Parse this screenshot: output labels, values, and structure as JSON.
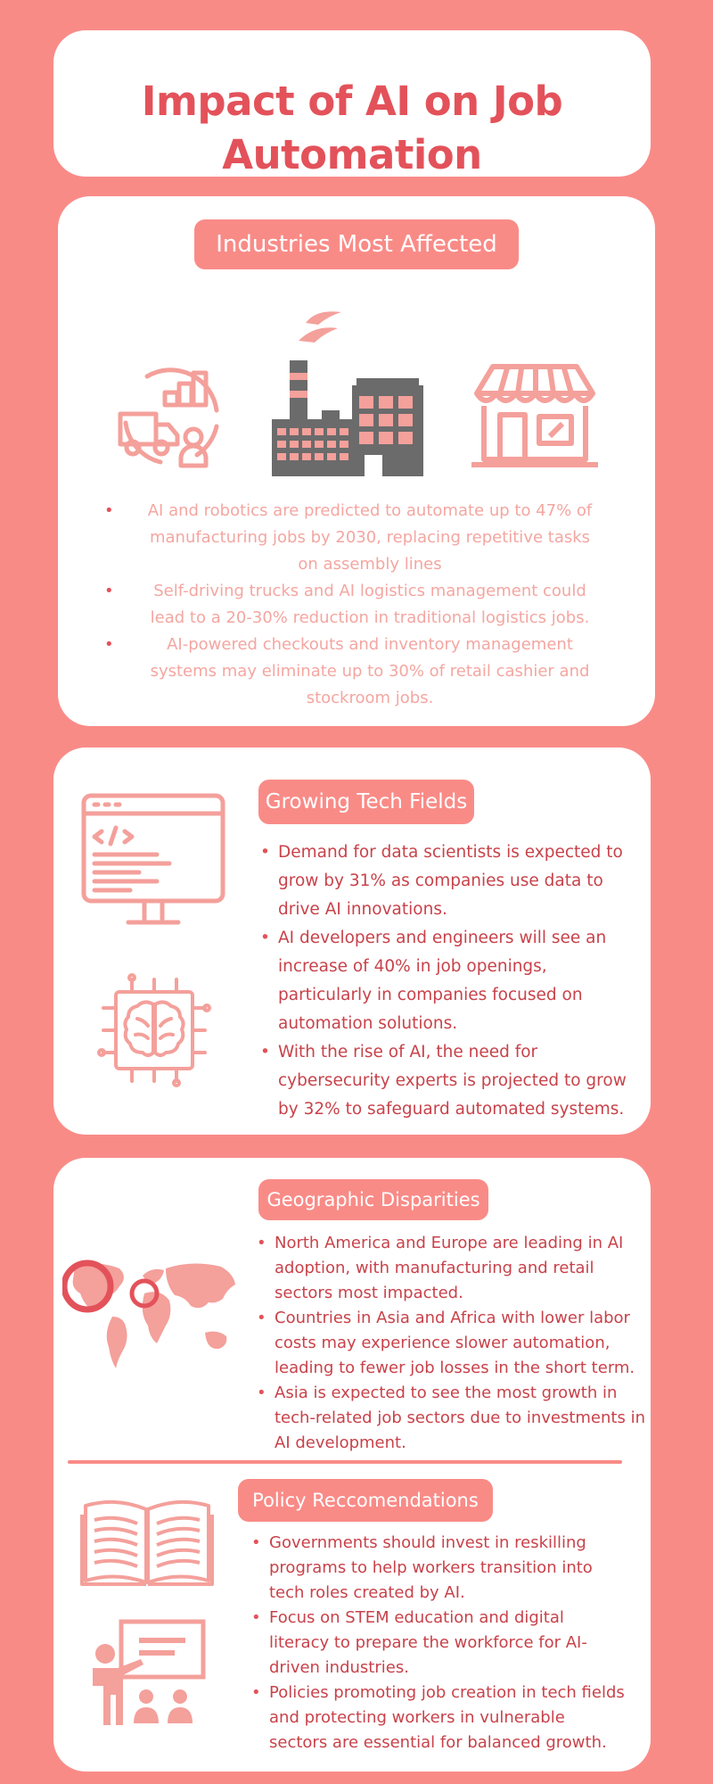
{
  "title": "Impact of AI on Job Automation",
  "colors": {
    "background": "#f98b87",
    "card": "#ffffff",
    "title": "#e3525a",
    "text": "#c8424a",
    "muted_text": "#f4a6a1",
    "factory": "#6b6b6b"
  },
  "industries": {
    "heading": "Industries Most Affected",
    "icons": [
      "logistics-icon",
      "factory-icon",
      "store-icon"
    ],
    "bullets": [
      "AI and robotics are predicted to automate up to 47% of manufacturing jobs by 2030, replacing repetitive tasks on assembly lines",
      "Self-driving trucks and AI logistics management could lead to a 20-30% reduction in traditional logistics jobs.",
      "AI-powered checkouts and inventory management systems may eliminate up to 30% of retail cashier and stockroom jobs."
    ]
  },
  "tech": {
    "heading": "Growing Tech Fields",
    "icons": [
      "computer-code-icon",
      "ai-brain-chip-icon"
    ],
    "bullets": [
      "Demand for data scientists is expected to grow by 31% as companies use data to drive AI innovations.",
      "AI developers and engineers will see an increase of 40% in job openings, particularly in companies focused on automation solutions.",
      "With the rise of AI, the need for cybersecurity experts is projected to grow by 32% to safeguard automated systems."
    ]
  },
  "geo": {
    "heading": "Geographic Disparities",
    "icons": [
      "world-map-icon"
    ],
    "bullets": [
      "North America and Europe are leading in AI adoption, with manufacturing and retail sectors most impacted.",
      "Countries in Asia and Africa with lower labor costs may experience slower automation, leading to fewer job losses in the short term.",
      "Asia is expected to see the most growth in tech-related job sectors due to investments in AI development."
    ]
  },
  "policy": {
    "heading": "Policy Reccomendations",
    "icons": [
      "open-book-icon",
      "classroom-teacher-icon"
    ],
    "bullets": [
      "Governments should invest in reskilling programs to help workers transition into tech roles created by AI.",
      "Focus on STEM education and digital literacy to prepare the workforce for AI-driven industries.",
      "Policies promoting job creation in tech fields and protecting workers in vulnerable sectors are essential for balanced growth."
    ]
  }
}
